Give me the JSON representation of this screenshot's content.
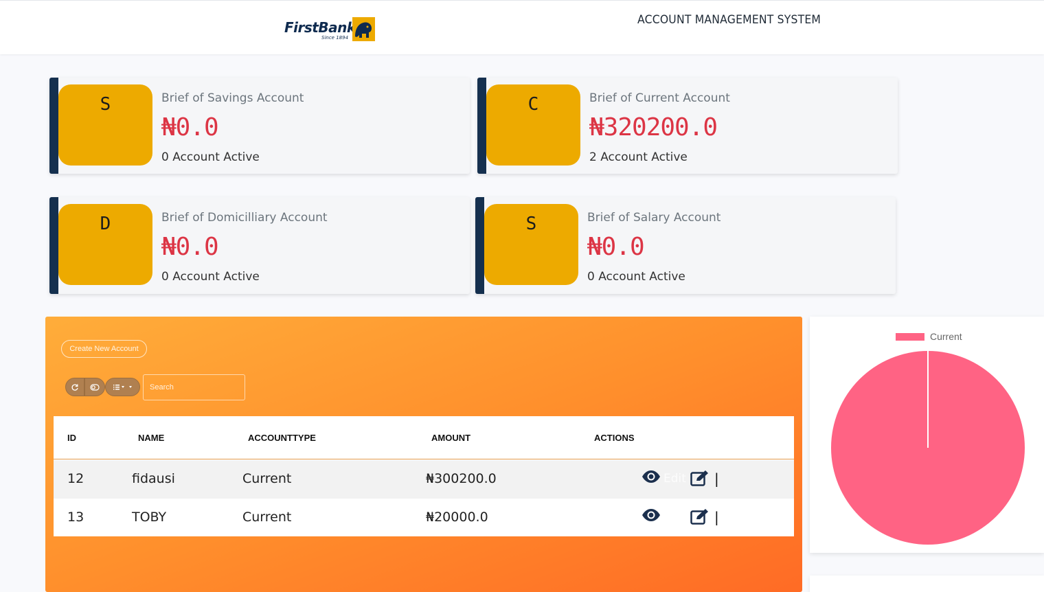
{
  "header": {
    "brand": "FirstBank",
    "since": "Since 1894",
    "system_title": "ACCOUNT MANAGEMENT SYSTEM"
  },
  "cards": [
    {
      "letter": "S",
      "title": "Brief of Savings Account",
      "amount": "₦0.0",
      "active": "0 Account Active"
    },
    {
      "letter": "C",
      "title": "Brief of Current Account",
      "amount": "₦320200.0",
      "active": "2 Account Active"
    },
    {
      "letter": "D",
      "title": "Brief of Domicilliary Account",
      "amount": "₦0.0",
      "active": "0 Account Active"
    },
    {
      "letter": "S",
      "title": "Brief of Salary Account",
      "amount": "₦0.0",
      "active": "0 Account Active"
    }
  ],
  "toolbar": {
    "create_label": "Create New Account",
    "search_placeholder": "Search"
  },
  "table": {
    "columns": [
      "ID",
      "NAME",
      "ACCOUNTTYPE",
      "AMOUNT",
      "ACTIONS"
    ],
    "rows": [
      {
        "id": "12",
        "name": "fidausi",
        "type": "Current",
        "amount": "₦300200.0",
        "pipe": "|",
        "ghost": "Edit"
      },
      {
        "id": "13",
        "name": "TOBY",
        "type": "Current",
        "amount": "₦20000.0",
        "pipe": "|",
        "ghost": ""
      }
    ]
  },
  "colors": {
    "accent_orange": "#ff8f2c",
    "badge_gold": "#edaa00",
    "card_border_navy": "#15304f",
    "amount_red": "#dc3545",
    "pie_pink": "#ff6384"
  },
  "chart_data": {
    "type": "pie",
    "legend": [
      "Current"
    ],
    "legend_position": "top",
    "series": [
      {
        "name": "Current",
        "values": [
          320200
        ]
      }
    ],
    "categories": [
      "Current"
    ],
    "color": "#ff6384"
  }
}
